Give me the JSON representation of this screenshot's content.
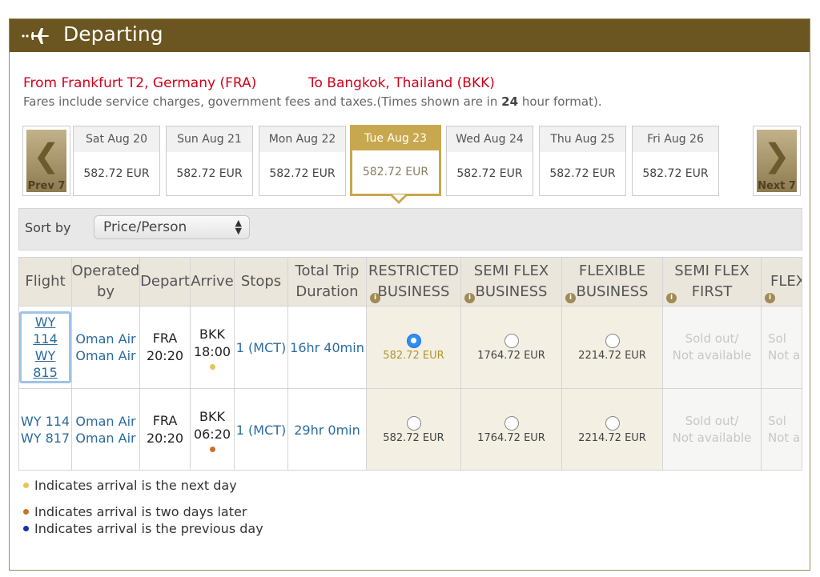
{
  "header": {
    "title": "Departing",
    "icon": "airplane-icon"
  },
  "route": {
    "from": "From Frankfurt T2, Germany (FRA)",
    "to": "To Bangkok, Thailand (BKK)",
    "note_prefix": "Fares include service charges, government fees and taxes.(Times shown are in",
    "note_bold": "24",
    "note_suffix": "hour format)."
  },
  "date_nav": {
    "prev_label": "Prev 7",
    "next_label": "Next 7",
    "days": [
      {
        "label": "Sat Aug 20",
        "price": "582.72 EUR"
      },
      {
        "label": "Sun Aug 21",
        "price": "582.72 EUR"
      },
      {
        "label": "Mon Aug 22",
        "price": "582.72 EUR"
      },
      {
        "label": "Tue Aug 23",
        "price": "582.72 EUR",
        "selected": true
      },
      {
        "label": "Wed Aug 24",
        "price": "582.72 EUR"
      },
      {
        "label": "Thu Aug 25",
        "price": "582.72 EUR"
      },
      {
        "label": "Fri Aug 26",
        "price": "582.72 EUR"
      }
    ]
  },
  "sort": {
    "label": "Sort by",
    "value": "Price/Person"
  },
  "table": {
    "headers": {
      "flight": "Flight",
      "operated_1": "Operated",
      "operated_2": "by",
      "depart": "Depart",
      "arrive": "Arrive",
      "stops": "Stops",
      "duration_1": "Total Trip",
      "duration_2": "Duration",
      "restricted_1": "RESTRICTED",
      "restricted_2": "BUSINESS",
      "semiflex_1": "SEMI FLEX",
      "semiflex_2": "BUSINESS",
      "flexible_1": "FLEXIBLE",
      "flexible_2": "BUSINESS",
      "semiflexfirst_1": "SEMI FLEX",
      "semiflexfirst_2": "FIRST",
      "flex": "FLEX"
    },
    "rows": [
      {
        "flight_1": "WY 114",
        "flight_2": "WY 815",
        "op_1": "Oman Air",
        "op_2": "Oman Air",
        "dep_code": "FRA",
        "dep_time": "20:20",
        "arr_code": "BKK",
        "arr_time": "18:00",
        "stops": "1 (MCT)",
        "duration": "16hr 40min",
        "restricted_price": "582.72 EUR",
        "semiflex_price": "1764.72 EUR",
        "flexible_price": "2214.72 EUR",
        "sold_1": "Sold out/",
        "sold_2": "Not available",
        "sold_clip_1": "Sol",
        "sold_clip_2": "Not a"
      },
      {
        "flight_1": "WY 114",
        "flight_2": "WY 817",
        "op_1": "Oman Air",
        "op_2": "Oman Air",
        "dep_code": "FRA",
        "dep_time": "20:20",
        "arr_code": "BKK",
        "arr_time": "06:20",
        "stops": "1 (MCT)",
        "duration": "29hr 0min",
        "restricted_price": "582.72 EUR",
        "semiflex_price": "1764.72 EUR",
        "flexible_price": "2214.72 EUR",
        "sold_1": "Sold out/",
        "sold_2": "Not available",
        "sold_clip_1": "Sol",
        "sold_clip_2": "Not a"
      }
    ]
  },
  "legend": {
    "next_day": "Indicates arrival is the next day",
    "two_days": "Indicates arrival is two days later",
    "prev_day": "Indicates arrival is the previous day"
  },
  "colors": {
    "header_bg": "#6b5520",
    "accent_gold": "#c8a84e",
    "route_red": "#d0021b",
    "link_blue": "#2a6ba0",
    "dot_next_day": "#e8c25a",
    "dot_two_days": "#c8712a",
    "dot_prev_day": "#1a2fb0"
  }
}
